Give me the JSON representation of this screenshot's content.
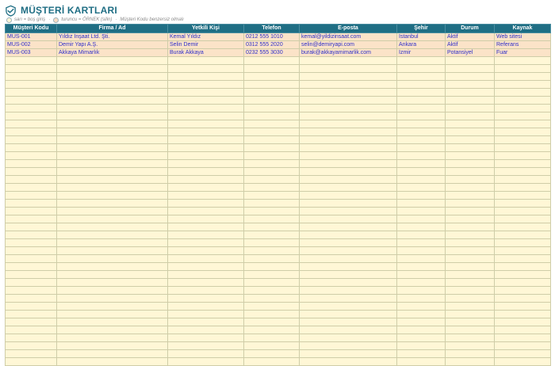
{
  "header": {
    "title": "MÜŞTERİ KARTLARI",
    "logo_icon": "handshake-icon"
  },
  "legend": {
    "yellow_text": "sarı = boş giriş",
    "orange_text": "turuncu = ÖRNEK (silin)",
    "note": "Müşteri Kodu benzersiz olmalı",
    "separator": "·"
  },
  "colors": {
    "header_bg": "#1f6e84",
    "empty_row": "#fff7d6",
    "example_row": "#fbe3c8",
    "text_blue": "#2f2fc8"
  },
  "table": {
    "columns": [
      "Müşteri Kodu",
      "Firma / Ad",
      "Yetkili Kişi",
      "Telefon",
      "E-posta",
      "Şehir",
      "Durum",
      "Kaynak"
    ],
    "rows": [
      [
        "MUS-001",
        "Yıldız İnşaat Ltd. Şti.",
        "Kemal Yıldız",
        "0212 555 1010",
        "kemal@yildizinsaat.com",
        "İstanbul",
        "Aktif",
        "Web sitesi"
      ],
      [
        "MUS-002",
        "Demir Yapı A.Ş.",
        "Selin Demir",
        "0312 555 2020",
        "selin@demiryapi.com",
        "Ankara",
        "Aktif",
        "Referans"
      ],
      [
        "MUS-003",
        "Akkaya Mimarlık",
        "Burak Akkaya",
        "0232 555 3030",
        "burak@akkayamimarlik.com",
        "İzmir",
        "Potansiyel",
        "Fuar"
      ]
    ],
    "empty_rows": 39
  }
}
